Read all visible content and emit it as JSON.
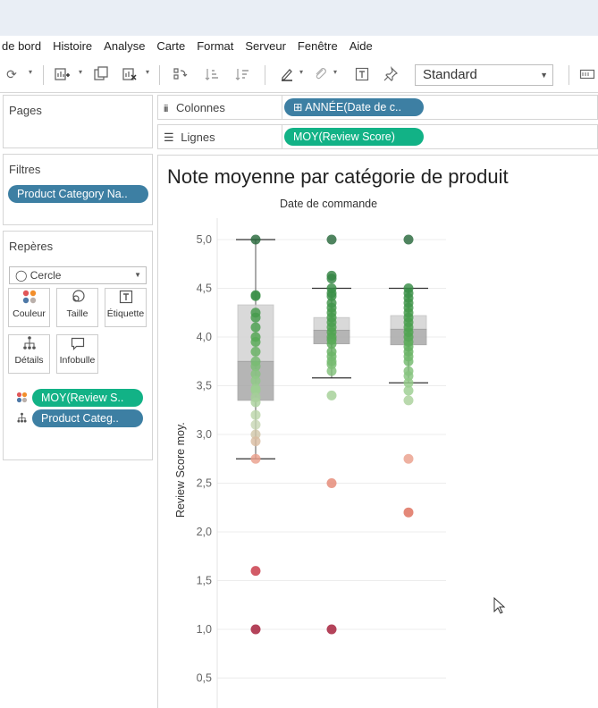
{
  "menu": [
    "de bord",
    "Histoire",
    "Analyse",
    "Carte",
    "Format",
    "Serveur",
    "Fenêtre",
    "Aide"
  ],
  "toolbar": {
    "fit_label": "Standard"
  },
  "pages": {
    "title": "Pages"
  },
  "filters": {
    "title": "Filtres",
    "pill": "Product Category Na.."
  },
  "marks": {
    "title": "Repères",
    "type_label": "◯ Cercle",
    "buttons": {
      "color": "Couleur",
      "size": "Taille",
      "label": "Étiquette",
      "detail": "Détails",
      "tooltip": "Infobulle"
    },
    "pill_color": "MOY(Review S..",
    "pill_detail": "Product Categ.."
  },
  "shelves": {
    "columns_label": "Colonnes",
    "columns_pill": "⊞ ANNÉE(Date de c..",
    "rows_label": "Lignes",
    "rows_pill": "MOY(Review Score)"
  },
  "view": {
    "title": "Note moyenne par catégorie de produit",
    "column_header": "Date de commande",
    "y_title": "Review Score moy."
  },
  "colors": {
    "pill_blue": "#3d7fa3",
    "pill_green": "#12b286",
    "low": "#a31a36",
    "mid": "#e89a84",
    "high": "#2b6e3c"
  },
  "chart_data": {
    "type": "scatter",
    "xlabel": "",
    "ylabel": "Review Score moy.",
    "ylim": [
      0.3,
      5.1
    ],
    "yticks": [
      "5,0",
      "4,5",
      "4,0",
      "3,5",
      "3,0",
      "2,5",
      "2,0",
      "1,5",
      "1,0",
      "0,5"
    ],
    "ytick_values": [
      5.0,
      4.5,
      4.0,
      3.5,
      3.0,
      2.5,
      2.0,
      1.5,
      1.0,
      0.5
    ],
    "grid": true,
    "columns": [
      {
        "values": [
          5.0,
          4.43,
          4.42,
          4.25,
          4.2,
          4.1,
          4.0,
          3.95,
          3.85,
          3.75,
          3.7,
          3.62,
          3.55,
          3.47,
          3.45,
          3.38,
          3.33,
          3.2,
          3.1,
          3.0,
          2.93,
          2.75,
          1.6,
          1.0
        ],
        "box": {
          "q1": 3.35,
          "median": 3.75,
          "q3": 4.33,
          "whisker_low": 2.75,
          "whisker_high": 5.0
        }
      },
      {
        "values": [
          5.0,
          4.63,
          4.6,
          4.5,
          4.45,
          4.42,
          4.35,
          4.3,
          4.25,
          4.2,
          4.15,
          4.1,
          4.05,
          4.0,
          3.97,
          3.93,
          3.85,
          3.8,
          3.75,
          3.72,
          3.65,
          3.4,
          2.5,
          1.0
        ],
        "box": {
          "q1": 3.93,
          "median": 4.07,
          "q3": 4.2,
          "whisker_low": 3.58,
          "whisker_high": 4.5
        }
      },
      {
        "values": [
          5.0,
          4.5,
          4.45,
          4.4,
          4.35,
          4.3,
          4.25,
          4.2,
          4.15,
          4.1,
          4.05,
          4.0,
          3.95,
          3.9,
          3.85,
          3.8,
          3.75,
          3.65,
          3.6,
          3.53,
          3.45,
          3.35,
          2.75,
          2.2
        ],
        "box": {
          "q1": 3.92,
          "median": 4.08,
          "q3": 4.22,
          "whisker_low": 3.53,
          "whisker_high": 4.5
        }
      }
    ]
  }
}
